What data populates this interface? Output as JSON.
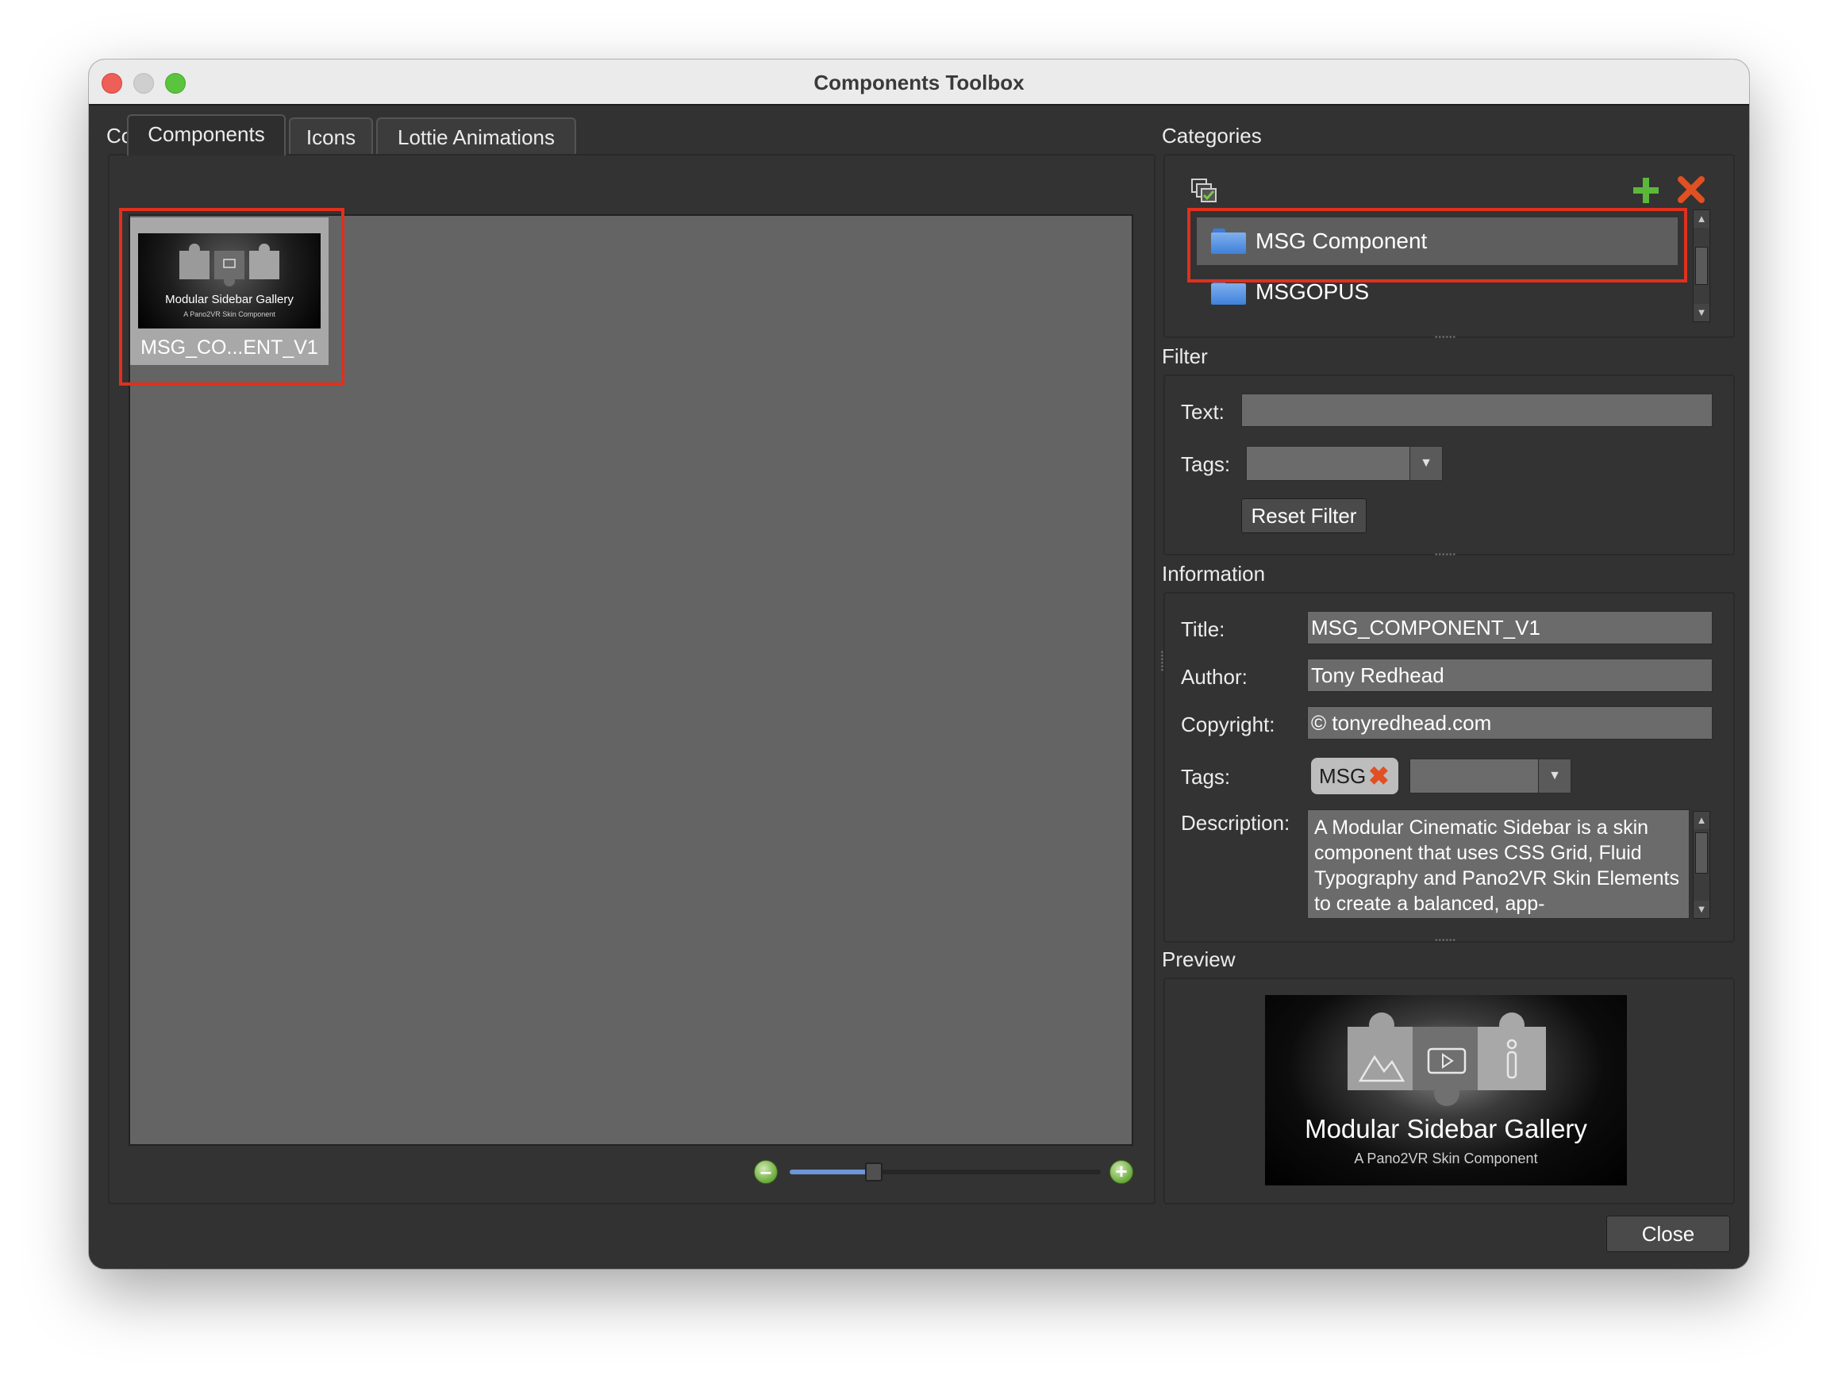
{
  "window": {
    "title": "Components Toolbox"
  },
  "content": {
    "label": "Content",
    "tabs": [
      {
        "label": "Components",
        "active": true
      },
      {
        "label": "Icons",
        "active": false
      },
      {
        "label": "Lottie Animations",
        "active": false
      }
    ],
    "items": [
      {
        "caption": "MSG_CO...ENT_V1",
        "thumb_title": "Modular Sidebar Gallery",
        "thumb_subtitle": "A Pano2VR Skin Component"
      }
    ],
    "zoom_slider": {
      "value": 0.27,
      "zoom_out_icon": "minus-circle-icon",
      "zoom_in_icon": "plus-circle-icon"
    }
  },
  "categories": {
    "label": "Categories",
    "items": [
      {
        "label": "MSG Component",
        "selected": true
      },
      {
        "label": "MSGOPUS",
        "selected": false
      }
    ]
  },
  "filter": {
    "label": "Filter",
    "text_label": "Text:",
    "text_value": "",
    "tags_label": "Tags:",
    "tags_value": "",
    "reset_label": "Reset Filter"
  },
  "information": {
    "label": "Information",
    "title_label": "Title:",
    "title_value": "MSG_COMPONENT_V1",
    "author_label": "Author:",
    "author_value": "Tony Redhead",
    "copyright_label": "Copyright:",
    "copyright_value": "© tonyredhead.com",
    "tags_label": "Tags:",
    "tag_chip": "MSG",
    "description_label": "Description:",
    "description_value": "A Modular Cinematic Sidebar is a skin component that uses CSS Grid, Fluid Typography and Pano2VR Skin Elements to create a balanced, app-"
  },
  "preview": {
    "label": "Preview",
    "image_title": "Modular Sidebar Gallery",
    "image_subtitle": "A Pano2VR Skin Component"
  },
  "footer": {
    "close_label": "Close"
  },
  "colors": {
    "highlight_box": "#e0301e",
    "accent_blue": "#6d95d8",
    "folder_blue": "#3f80da"
  }
}
